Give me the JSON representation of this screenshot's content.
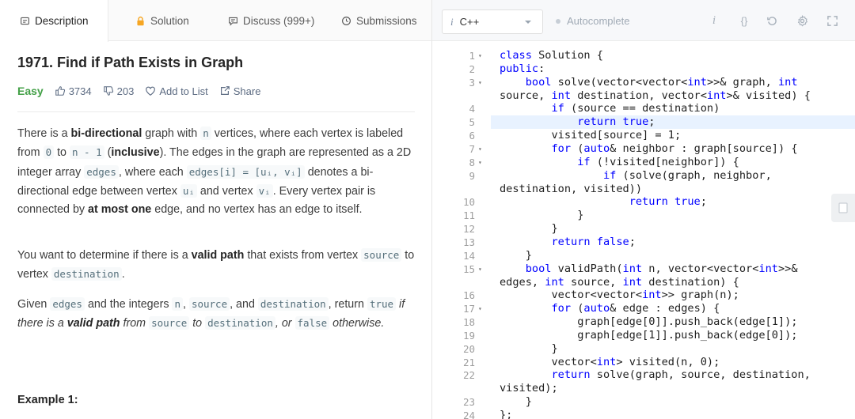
{
  "tabs": [
    {
      "label": "Description",
      "icon": "description-icon"
    },
    {
      "label": "Solution",
      "icon": "lock-icon"
    },
    {
      "label": "Discuss (999+)",
      "icon": "discuss-icon"
    },
    {
      "label": "Submissions",
      "icon": "clock-icon"
    }
  ],
  "problem": {
    "title": "1971. Find if Path Exists in Graph",
    "difficulty": "Easy",
    "likes": "3734",
    "dislikes": "203",
    "add_to_list": "Add to List",
    "share": "Share",
    "p1": {
      "t1": "There is a ",
      "b1": "bi-directional",
      "t2": " graph with ",
      "c1": "n",
      "t3": " vertices, where each vertex is labeled from ",
      "c2": "0",
      "t4": " to ",
      "c3": "n - 1",
      "t5": " (",
      "b2": "inclusive",
      "t6": "). The edges in the graph are represented as a 2D integer array ",
      "c4": "edges",
      "t7": ", where each ",
      "c5": "edges[i] = [uᵢ, vᵢ]",
      "t8": " denotes a bi-directional edge between vertex ",
      "c6": "uᵢ",
      "t9": " and vertex ",
      "c7": "vᵢ",
      "t10": ". Every vertex pair is connected by ",
      "b3": "at most one",
      "t11": " edge, and no vertex has an edge to itself."
    },
    "p2": {
      "t1": "You want to determine if there is a ",
      "b1": "valid path",
      "t2": " that exists from vertex ",
      "c1": "source",
      "t3": " to vertex ",
      "c2": "destination",
      "t4": "."
    },
    "p3": {
      "t1": "Given ",
      "c1": "edges",
      "t2": " and the integers ",
      "c2": "n",
      "t3": ", ",
      "c3": "source",
      "t4": ", and ",
      "c4": "destination",
      "t5": ", return ",
      "c5": "true",
      "t6": " if there is a ",
      "b1": "valid path",
      "t7": " from ",
      "c6": "source",
      "t8": " to ",
      "c7": "destination",
      "t9": ", or ",
      "c8": "false",
      "t10": " otherwise."
    },
    "example_heading": "Example 1:"
  },
  "editor": {
    "language": "C++",
    "autocomplete": "Autocomplete",
    "info_glyph": "i",
    "braces_glyph": "{}",
    "code": [
      {
        "n": "1",
        "fold": true,
        "text": "class Solution {"
      },
      {
        "n": "2",
        "fold": false,
        "text": "public:"
      },
      {
        "n": "3",
        "fold": true,
        "text": "    bool solve(vector<vector<int>>& graph, int"
      },
      {
        "n": "",
        "fold": false,
        "text": "source, int destination, vector<int>& visited) {"
      },
      {
        "n": "4",
        "fold": false,
        "text": "        if (source == destination)"
      },
      {
        "n": "5",
        "fold": false,
        "text": "            return true;"
      },
      {
        "n": "6",
        "fold": false,
        "text": "        visited[source] = 1;"
      },
      {
        "n": "7",
        "fold": true,
        "text": "        for (auto& neighbor : graph[source]) {"
      },
      {
        "n": "8",
        "fold": true,
        "text": "            if (!visited[neighbor]) {"
      },
      {
        "n": "9",
        "fold": false,
        "text": "                if (solve(graph, neighbor,"
      },
      {
        "n": "",
        "fold": false,
        "text": "destination, visited))"
      },
      {
        "n": "10",
        "fold": false,
        "text": "                    return true;"
      },
      {
        "n": "11",
        "fold": false,
        "text": "            }"
      },
      {
        "n": "12",
        "fold": false,
        "text": "        }"
      },
      {
        "n": "13",
        "fold": false,
        "text": "        return false;"
      },
      {
        "n": "14",
        "fold": false,
        "text": "    }"
      },
      {
        "n": "15",
        "fold": true,
        "text": "    bool validPath(int n, vector<vector<int>>&"
      },
      {
        "n": "",
        "fold": false,
        "text": "edges, int source, int destination) {"
      },
      {
        "n": "16",
        "fold": false,
        "text": "        vector<vector<int>> graph(n);"
      },
      {
        "n": "17",
        "fold": true,
        "text": "        for (auto& edge : edges) {"
      },
      {
        "n": "18",
        "fold": false,
        "text": "            graph[edge[0]].push_back(edge[1]);"
      },
      {
        "n": "19",
        "fold": false,
        "text": "            graph[edge[1]].push_back(edge[0]);"
      },
      {
        "n": "20",
        "fold": false,
        "text": "        }"
      },
      {
        "n": "21",
        "fold": false,
        "text": "        vector<int> visited(n, 0);"
      },
      {
        "n": "22",
        "fold": false,
        "text": "        return solve(graph, source, destination,"
      },
      {
        "n": "",
        "fold": false,
        "text": "visited);"
      },
      {
        "n": "23",
        "fold": false,
        "text": "    }"
      },
      {
        "n": "24",
        "fold": false,
        "text": "};"
      }
    ],
    "highlighted_line": "5"
  },
  "colors": {
    "easy": "#43a047",
    "keyword": "#0000ff",
    "highlight": "#e8f2ff"
  }
}
